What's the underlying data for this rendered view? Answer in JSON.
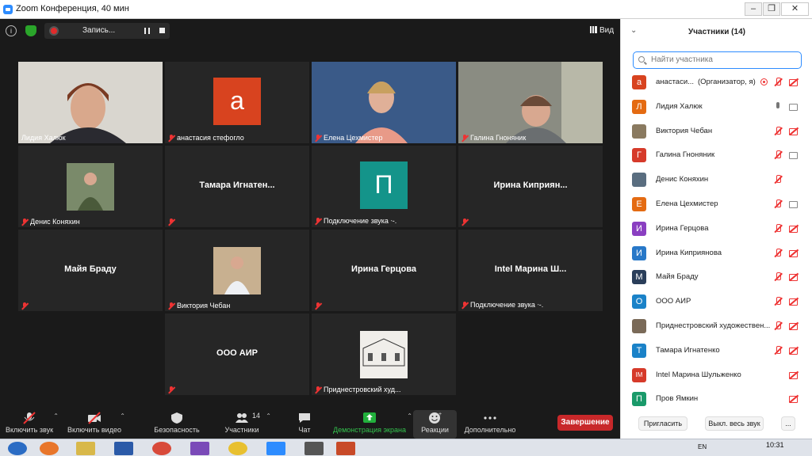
{
  "window": {
    "title": "Zoom Конференция, 40 мин",
    "min": "–",
    "max": "❐",
    "close": "✕"
  },
  "topbar": {
    "info": "i",
    "recording": "Запись...",
    "view": "Вид"
  },
  "tiles": [
    {
      "name": "Лидия Халюк",
      "kind": "video",
      "active": true
    },
    {
      "name": "анастасия стефогло",
      "kind": "avatar",
      "letter": "а",
      "color": "#d8431f"
    },
    {
      "name": "Елена Цехмистер",
      "kind": "video"
    },
    {
      "name": "Галина Гноняник",
      "kind": "video"
    },
    {
      "name": "Денис Коняхин",
      "kind": "photo"
    },
    {
      "name": "",
      "big": "Тамара Игнатен...",
      "kind": "text"
    },
    {
      "name": "Подключение звука ᐧ-.",
      "kind": "avatar",
      "letter": "П",
      "color": "#14948a"
    },
    {
      "name": "",
      "big": "Ирина Киприян...",
      "kind": "text"
    },
    {
      "name": "",
      "big": "Майя Браду",
      "kind": "text"
    },
    {
      "name": "Виктория Чебан",
      "kind": "photo"
    },
    {
      "name": "",
      "big": "Ирина Герцова",
      "kind": "text"
    },
    {
      "name": "Подключение звука ᐧ-.",
      "big": "Intel Марина Ш...",
      "kind": "text"
    },
    {
      "name": "",
      "big": "ООО АИР",
      "kind": "text"
    },
    {
      "name": "Приднестровский худ...",
      "kind": "photo"
    }
  ],
  "toolbar": {
    "mute": "Включить звук",
    "video": "Включить видео",
    "security": "Безопасность",
    "participants": "Участники",
    "participants_count": "14",
    "chat": "Чат",
    "share": "Демонстрация экрана",
    "reactions": "Реакции",
    "more": "Дополнительно",
    "end": "Завершение"
  },
  "panel": {
    "title": "Участники (14)",
    "search_placeholder": "Найти участника",
    "invite": "Пригласить",
    "mute_all": "Выкл. весь звук",
    "more": "...",
    "participants": [
      {
        "letter": "а",
        "color": "#d8431f",
        "name": "анастаси...",
        "role": "(Организатор, я)",
        "mic": "off",
        "video": "off",
        "rec": true
      },
      {
        "letter": "Л",
        "color": "#e46b12",
        "name": "Лидия Халюк",
        "mic": "on",
        "video": "on"
      },
      {
        "letter": "",
        "color": "#8a7a60",
        "name": "Виктория Чебан",
        "mic": "off",
        "video": "off"
      },
      {
        "letter": "Г",
        "color": "#d63a2a",
        "name": "Галина Гноняник",
        "mic": "off",
        "video": "on"
      },
      {
        "letter": "",
        "color": "#5a6e80",
        "name": "Денис Коняхин",
        "mic": "off",
        "video": "none"
      },
      {
        "letter": "Е",
        "color": "#e46b12",
        "name": "Елена Цехмистер",
        "mic": "off",
        "video": "on"
      },
      {
        "letter": "И",
        "color": "#8a3fc1",
        "name": "Ирина Герцова",
        "mic": "off",
        "video": "off"
      },
      {
        "letter": "И",
        "color": "#2878c8",
        "name": "Ирина Киприянова",
        "mic": "off",
        "video": "off"
      },
      {
        "letter": "М",
        "color": "#2a3e5a",
        "name": "Майя Браду",
        "mic": "off",
        "video": "off"
      },
      {
        "letter": "О",
        "color": "#1a82c8",
        "name": "ООО АИР",
        "mic": "off",
        "video": "off"
      },
      {
        "letter": "",
        "color": "#7a6a58",
        "name": "Приднестровский художествен...",
        "mic": "off",
        "video": "off"
      },
      {
        "letter": "Т",
        "color": "#1a82c8",
        "name": "Тамара Игнатенко",
        "mic": "off",
        "video": "off"
      },
      {
        "letter": "IM",
        "color": "#d63a2a",
        "name": "Intel Марина Шульженко",
        "mic": "none",
        "video": "off"
      },
      {
        "letter": "П",
        "color": "#1a9a6a",
        "name": "Пров Ямкин",
        "mic": "none",
        "video": "off"
      }
    ]
  },
  "taskbar": {
    "lang": "EN",
    "time": "10:31"
  }
}
